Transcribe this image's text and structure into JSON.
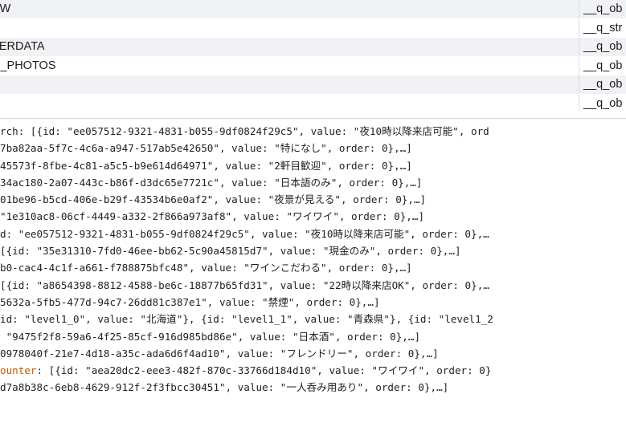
{
  "table": {
    "rows": [
      {
        "name": "EW",
        "type": "__q_ob"
      },
      {
        "name": "",
        "type": "__q_str"
      },
      {
        "name": "TERDATA",
        "type": "__q_ob"
      },
      {
        "name": "U_PHOTOS",
        "type": "__q_ob"
      },
      {
        "name": "",
        "type": "__q_ob"
      },
      {
        "name": "",
        "type": "__q_ob"
      }
    ]
  },
  "console": {
    "lines": [
      {
        "prefix": "",
        "text": "rch: [{id: \"ee057512-9321-4831-b055-9df0824f29c5\", value: \"夜10時以降来店可能\", ord"
      },
      {
        "prefix": "",
        "text": "7ba82aa-5f7c-4c6a-a947-517ab5e42650\", value: \"特になし\", order: 0},…]"
      },
      {
        "prefix": "",
        "text": "45573f-8fbe-4c81-a5c5-b9e614d64971\", value: \"2軒目歓迎\", order: 0},…]"
      },
      {
        "prefix": "",
        "text": "34ac180-2a07-443c-b86f-d3dc65e7721c\", value: \"日本語のみ\", order: 0},…]"
      },
      {
        "prefix": "",
        "text": "01be96-b5cd-406e-b29f-43534b6e0af2\", value: \"夜景が見える\", order: 0},…]"
      },
      {
        "prefix": "",
        "text": "\"1e310ac8-06cf-4449-a332-2f866a973af8\", value: \"ワイワイ\", order: 0},…]"
      },
      {
        "prefix": "",
        "text": "d: \"ee057512-9321-4831-b055-9df0824f29c5\", value: \"夜10時以降来店可能\", order: 0},…"
      },
      {
        "prefix": "",
        "text": "[{id: \"35e31310-7fd0-46ee-bb62-5c90a45815d7\", value: \"現金のみ\", order: 0},…]"
      },
      {
        "prefix": "",
        "text": "b0-cac4-4c1f-a661-f788875bfc48\", value: \"ワインこだわる\", order: 0},…]"
      },
      {
        "prefix": "",
        "text": "[{id: \"a8654398-8812-4588-be6c-18877b65fd31\", value: \"22時以降来店OK\", order: 0},…"
      },
      {
        "prefix": "",
        "text": "5632a-5fb5-477d-94c7-26dd81c387e1\", value: \"禁煙\", order: 0},…]"
      },
      {
        "prefix": "",
        "text": "id: \"level1_0\", value: \"北海道\"}, {id: \"level1_1\", value: \"青森県\"}, {id: \"level1_2"
      },
      {
        "prefix": "",
        "text": " \"9475f2f8-59a6-4f25-85cf-916d985bd86e\", value: \"日本酒\", order: 0},…]"
      },
      {
        "prefix": "",
        "text": "0978040f-21e7-4d18-a35c-ada6d6f4ad10\", value: \"フレンドリー\", order: 0},…]"
      },
      {
        "prefix": "ounter",
        "text": ": [{id: \"aea20dc2-eee3-482f-870c-33766d184d10\", value: \"ワイワイ\", order: 0}"
      },
      {
        "prefix": "",
        "text": "d7a8b38c-6eb8-4629-912f-2f3fbcc30451\", value: \"一人呑み用あり\", order: 0},…]"
      }
    ]
  },
  "colors": {
    "row_alt": "#f0f2f6",
    "key_accent": "#c25b00",
    "divider": "#c9d6ea"
  }
}
